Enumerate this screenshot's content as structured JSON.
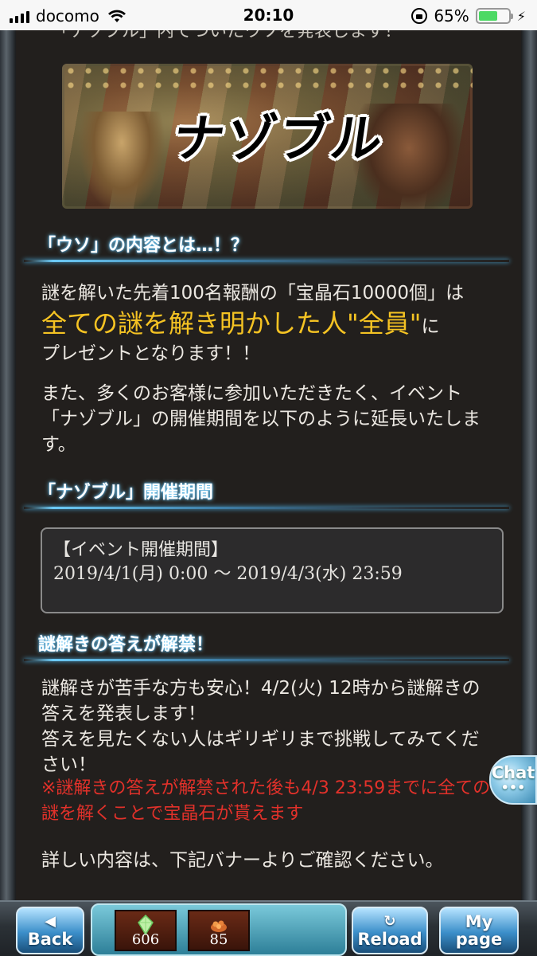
{
  "status_bar": {
    "carrier": "docomo",
    "time": "20:10",
    "battery_percent": "65%",
    "battery_level": 0.65,
    "battery_color": "#4cd964"
  },
  "article": {
    "cut_line": "「ナゾブル」内でついたウソを発表します！",
    "banner_logo": "ナゾブル",
    "heading1": "「ウソ」の内容とは…！？",
    "para1_line1": "謎を解いた先着100名報酬の「宝晶石10000個」は",
    "para1_big": "全ての謎を解き明かした人\"全員\"",
    "para1_suffix": "に",
    "para1_line3": "プレゼントとなります！！",
    "para2": "また、多くのお客様に参加いただきたく、イベント「ナゾブル」の開催期間を以下のように延長いたします。",
    "heading2": "「ナゾブル」開催期間",
    "period_label": "【イベント開催期間】",
    "period_value": "2019/4/1(月) 0:00 〜 2019/4/3(水) 23:59",
    "heading3": "謎解きの答えが解禁！",
    "para3_line1": "謎解きが苦手な方も安心！4/2(火) 12時から謎解きの答えを発表します！",
    "para3_line2": "答えを見たくない人はギリギリまで挑戦してみてください！",
    "red_note": "※謎解きの答えが解禁された後も4/3 23:59までに全ての謎を解くことで宝晶石が貰えます",
    "para4": "詳しい内容は、下記バナーよりご確認ください。",
    "accent_color": "#f5c323",
    "warning_color": "#e2312a"
  },
  "chat_button": {
    "label": "Chat",
    "icon": "ellipsis-icon"
  },
  "bottom_bar": {
    "back_label": "Back",
    "back_icon": "left-arrow-icon",
    "crystal_count": "606",
    "crystal_icon": "crystal-gem-icon",
    "jewel_count": "85",
    "jewel_icon": "jewel-pile-icon",
    "reload_label": "Reload",
    "reload_icon": "refresh-icon",
    "mypage_label_1": "My",
    "mypage_label_2": "page"
  }
}
